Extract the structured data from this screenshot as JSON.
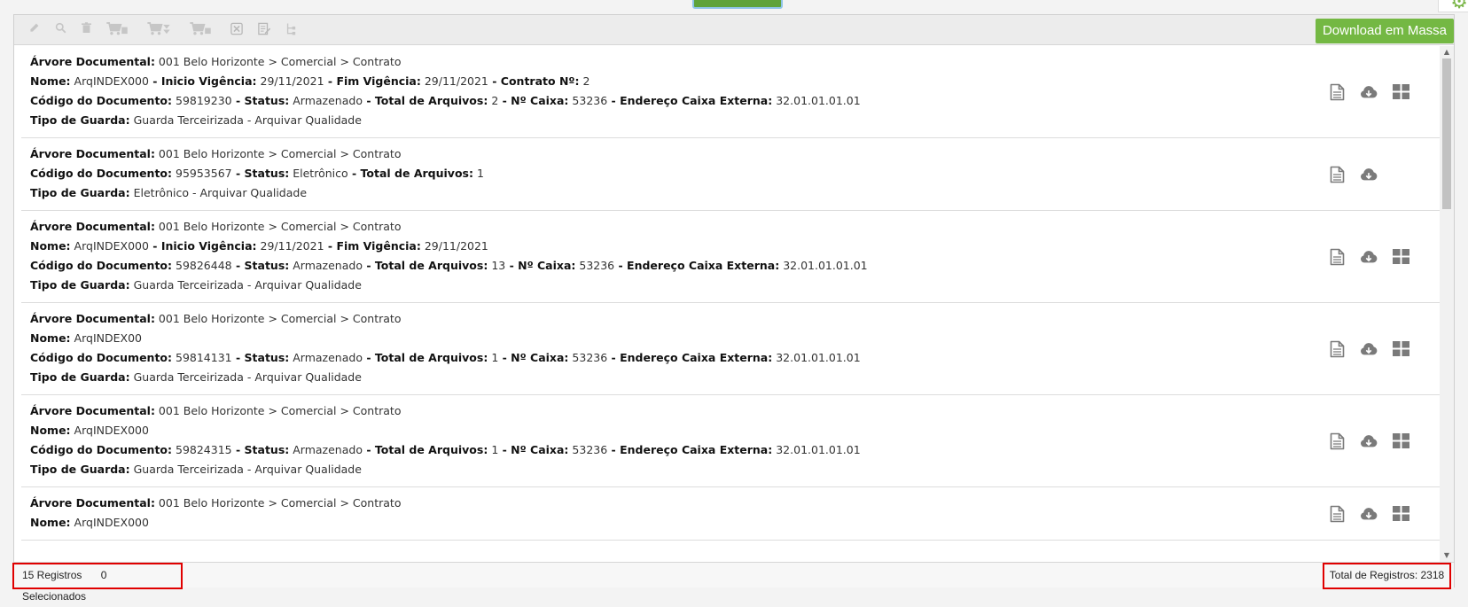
{
  "toolbar": {
    "icons": [
      "pencil-icon",
      "search-icon",
      "trash-icon",
      "cart-add-icon",
      "cart-remove-icon",
      "cart-list-icon",
      "excel-icon",
      "edit-document-icon",
      "tree-icon"
    ],
    "download_mass_label": "Download em Massa"
  },
  "records": [
    {
      "lines": [
        [
          {
            "label": "Árvore Documental:",
            "value": "001 Belo Horizonte > Comercial > Contrato"
          }
        ],
        [
          {
            "label": "Nome:",
            "value": "ArqINDEX000"
          },
          {
            "label": "Inicio Vigência:",
            "value": "29/11/2021"
          },
          {
            "label": "Fim Vigência:",
            "value": "29/11/2021"
          },
          {
            "label": "Contrato Nº:",
            "value": "2"
          }
        ],
        [
          {
            "label": "Código do Documento:",
            "value": "59819230"
          },
          {
            "label": "Status:",
            "value": "Armazenado"
          },
          {
            "label": "Total de Arquivos:",
            "value": "2"
          },
          {
            "label": "Nº Caixa:",
            "value": "53236"
          },
          {
            "label": "Endereço Caixa Externa:",
            "value": "32.01.01.01.01"
          }
        ],
        [
          {
            "label": "Tipo de Guarda:",
            "value": "Guarda Terceirizada - Arquivar Qualidade"
          }
        ]
      ],
      "actions": [
        "document-icon",
        "cloud-download-icon",
        "grid-icon"
      ]
    },
    {
      "lines": [
        [
          {
            "label": "Árvore Documental:",
            "value": "001 Belo Horizonte > Comercial > Contrato"
          }
        ],
        [
          {
            "label": "Código do Documento:",
            "value": "95953567"
          },
          {
            "label": "Status:",
            "value": "Eletrônico"
          },
          {
            "label": "Total de Arquivos:",
            "value": "1"
          }
        ],
        [
          {
            "label": "Tipo de Guarda:",
            "value": "Eletrônico - Arquivar Qualidade"
          }
        ]
      ],
      "actions": [
        "document-icon",
        "cloud-download-icon"
      ]
    },
    {
      "lines": [
        [
          {
            "label": "Árvore Documental:",
            "value": "001 Belo Horizonte > Comercial > Contrato"
          }
        ],
        [
          {
            "label": "Nome:",
            "value": "ArqINDEX000"
          },
          {
            "label": "Inicio Vigência:",
            "value": "29/11/2021"
          },
          {
            "label": "Fim Vigência:",
            "value": "29/11/2021"
          }
        ],
        [
          {
            "label": "Código do Documento:",
            "value": "59826448"
          },
          {
            "label": "Status:",
            "value": "Armazenado"
          },
          {
            "label": "Total de Arquivos:",
            "value": "13"
          },
          {
            "label": "Nº Caixa:",
            "value": "53236"
          },
          {
            "label": "Endereço Caixa Externa:",
            "value": "32.01.01.01.01"
          }
        ],
        [
          {
            "label": "Tipo de Guarda:",
            "value": "Guarda Terceirizada - Arquivar Qualidade"
          }
        ]
      ],
      "actions": [
        "document-icon",
        "cloud-download-icon",
        "grid-icon"
      ]
    },
    {
      "lines": [
        [
          {
            "label": "Árvore Documental:",
            "value": "001 Belo Horizonte > Comercial > Contrato"
          }
        ],
        [
          {
            "label": "Nome:",
            "value": "ArqINDEX00"
          }
        ],
        [
          {
            "label": "Código do Documento:",
            "value": "59814131"
          },
          {
            "label": "Status:",
            "value": "Armazenado"
          },
          {
            "label": "Total de Arquivos:",
            "value": "1"
          },
          {
            "label": "Nº Caixa:",
            "value": "53236"
          },
          {
            "label": "Endereço Caixa Externa:",
            "value": "32.01.01.01.01"
          }
        ],
        [
          {
            "label": "Tipo de Guarda:",
            "value": "Guarda Terceirizada - Arquivar Qualidade"
          }
        ]
      ],
      "actions": [
        "document-icon",
        "cloud-download-icon",
        "grid-icon"
      ]
    },
    {
      "lines": [
        [
          {
            "label": "Árvore Documental:",
            "value": "001 Belo Horizonte > Comercial > Contrato"
          }
        ],
        [
          {
            "label": "Nome:",
            "value": "ArqINDEX000"
          }
        ],
        [
          {
            "label": "Código do Documento:",
            "value": "59824315"
          },
          {
            "label": "Status:",
            "value": "Armazenado"
          },
          {
            "label": "Total de Arquivos:",
            "value": "1"
          },
          {
            "label": "Nº Caixa:",
            "value": "53236"
          },
          {
            "label": "Endereço Caixa Externa:",
            "value": "32.01.01.01.01"
          }
        ],
        [
          {
            "label": "Tipo de Guarda:",
            "value": "Guarda Terceirizada - Arquivar Qualidade"
          }
        ]
      ],
      "actions": [
        "document-icon",
        "cloud-download-icon",
        "grid-icon"
      ]
    },
    {
      "lines": [
        [
          {
            "label": "Árvore Documental:",
            "value": "001 Belo Horizonte > Comercial > Contrato"
          }
        ],
        [
          {
            "label": "Nome:",
            "value": "ArqINDEX000"
          }
        ]
      ],
      "actions": [
        "document-icon",
        "cloud-download-icon",
        "grid-icon"
      ]
    }
  ],
  "footer": {
    "registros": "15 Registros",
    "selecionados": "0 Selecionados",
    "total": "Total de Registros: 2318"
  },
  "colors": {
    "accent_green": "#74b843",
    "highlight_red": "#e00000",
    "icon_gray": "#7a7a7a"
  }
}
